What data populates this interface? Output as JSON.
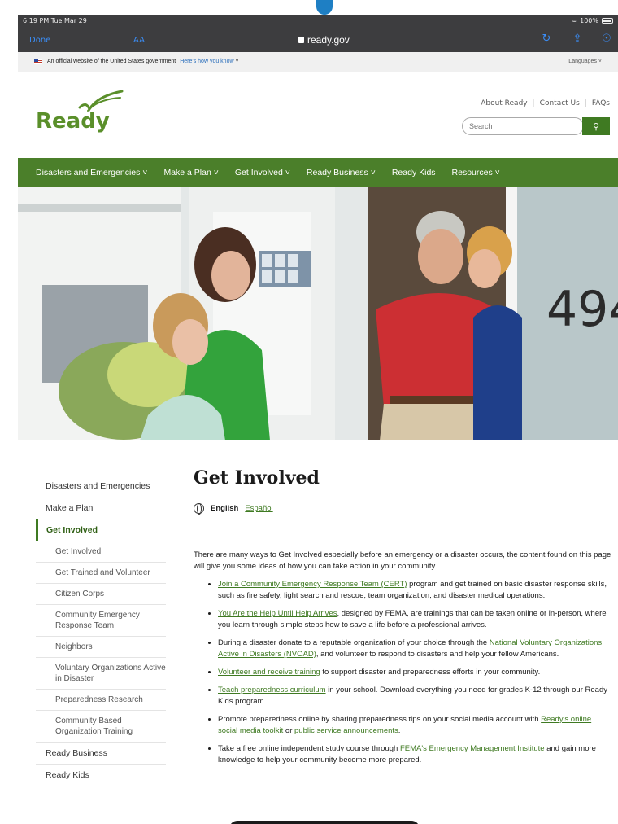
{
  "status": {
    "time": "6:19 PM  Tue Mar 29",
    "battery": "100%"
  },
  "browser": {
    "done": "Done",
    "aa": "AA",
    "url": "ready.gov"
  },
  "gov_banner": {
    "text": "An official website of the United States government",
    "link": "Here's how you know",
    "languages": "Languages"
  },
  "header": {
    "logo": "Ready",
    "links": [
      "About Ready",
      "Contact Us",
      "FAQs"
    ],
    "search_placeholder": "Search"
  },
  "nav": [
    "Disasters and Emergencies",
    "Make a Plan",
    "Get Involved",
    "Ready Business",
    "Ready Kids",
    "Resources"
  ],
  "hero": {
    "house_number": "494"
  },
  "sidebar": {
    "top": [
      "Disasters and Emergencies",
      "Make a Plan"
    ],
    "active": "Get Involved",
    "sub": [
      "Get Involved",
      "Get Trained and Volunteer",
      "Citizen Corps",
      "Community Emergency Response Team",
      "Neighbors",
      "Voluntary Organizations Active in Disaster",
      "Preparedness Research",
      "Community Based Organization Training"
    ],
    "bottom": [
      "Ready Business",
      "Ready Kids"
    ]
  },
  "main": {
    "title": "Get Involved",
    "lang_current": "English",
    "lang_other": "Español",
    "intro": "There are many ways to Get Involved especially before an emergency or a disaster occurs, the content found on this page will give you some ideas of how you can take action in your community.",
    "b1_link": "Join a Community Emergency Response Team (CERT)",
    "b1_text": " program and get trained on basic disaster response skills, such as fire safety, light search and rescue, team organization, and disaster medical operations.",
    "b2_link": "You Are the Help Until Help Arrives",
    "b2_text": ", designed by FEMA, are trainings that can be taken online or in-person, where you learn through simple steps how to save a life before a professional arrives.",
    "b3_pre": "During a disaster donate to a reputable organization of your choice through the ",
    "b3_link": "National Voluntary Organizations Active in Disasters (NVOAD)",
    "b3_text": ", and volunteer to respond to disasters and help your fellow Americans.",
    "b4_link": "Volunteer and receive training",
    "b4_text": " to support disaster and preparedness efforts in your community.",
    "b5_link": "Teach preparedness curriculum",
    "b5_text": " in your school. Download everything you need for grades K-12 through our Ready Kids program.",
    "b6_pre": "Promote preparedness online by sharing preparedness tips on your social media account with ",
    "b6_link1": "Ready's online social media toolkit",
    "b6_mid": " or ",
    "b6_link2": "public service announcements",
    "b6_end": ".",
    "b7_pre": "Take a free online independent study course through ",
    "b7_link": "FEMA's Emergency Management Institute",
    "b7_text": " and gain more knowledge to help your community become more prepared."
  }
}
